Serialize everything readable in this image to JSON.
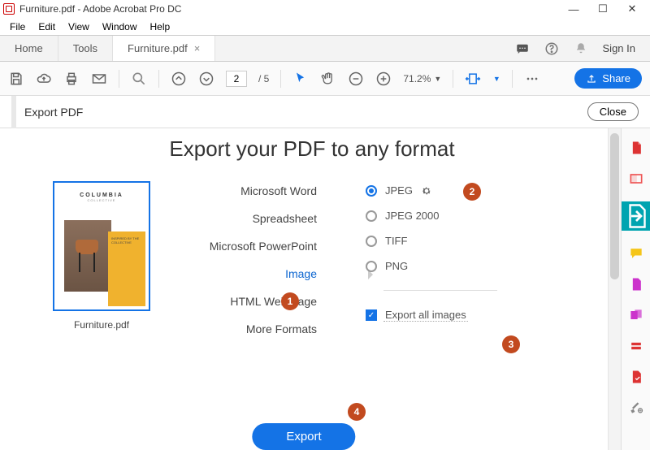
{
  "titlebar": {
    "text": "Furniture.pdf - Adobe Acrobat Pro DC"
  },
  "menu": {
    "items": [
      "File",
      "Edit",
      "View",
      "Window",
      "Help"
    ]
  },
  "tabs": {
    "home": "Home",
    "tools": "Tools",
    "doc": "Furniture.pdf",
    "signin": "Sign In"
  },
  "toolbar": {
    "page_current": "2",
    "page_total": "/ 5",
    "zoom": "71.2%",
    "share": "Share"
  },
  "panel": {
    "title": "Export PDF",
    "close": "Close"
  },
  "heading": "Export your PDF to any format",
  "thumb": {
    "title": "COLUMBIA",
    "subtitle": "COLLECTIVE",
    "sidetext": "INSPIRED BY THE COLLECTIVE",
    "filename": "Furniture.pdf"
  },
  "types": {
    "word": "Microsoft Word",
    "spreadsheet": "Spreadsheet",
    "ppt": "Microsoft PowerPoint",
    "image": "Image",
    "html": "HTML Web Page",
    "more": "More Formats"
  },
  "opts": {
    "jpeg": "JPEG",
    "jpeg2000": "JPEG 2000",
    "tiff": "TIFF",
    "png": "PNG",
    "export_all": "Export all images"
  },
  "export_btn": "Export",
  "badges": {
    "b1": "1",
    "b2": "2",
    "b3": "3",
    "b4": "4"
  },
  "colors": {
    "accent": "#1473e6",
    "badge": "#c24a1f",
    "teal": "#00a4b0"
  }
}
